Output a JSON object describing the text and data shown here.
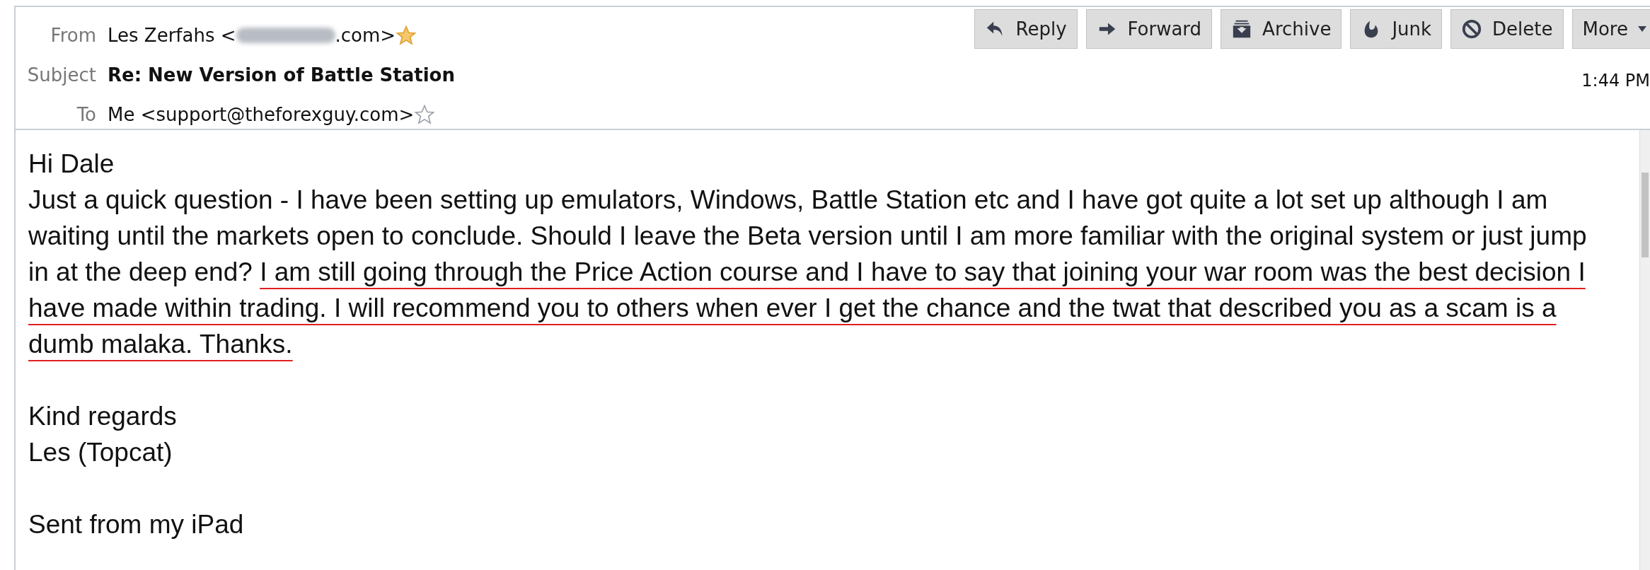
{
  "toolbar": [
    {
      "kind": "reply",
      "label": "Reply"
    },
    {
      "kind": "forward",
      "label": "Forward"
    },
    {
      "kind": "archive",
      "label": "Archive"
    },
    {
      "kind": "junk",
      "label": "Junk"
    },
    {
      "kind": "delete",
      "label": "Delete"
    },
    {
      "kind": "more",
      "label": "More"
    }
  ],
  "header": {
    "from": {
      "label": "From",
      "name": "Les Zerfahs <",
      "address_end": ".com>",
      "redacted": true,
      "starred": true
    },
    "subject": {
      "label": "Subject",
      "text": "Re: New Version of Battle Station"
    },
    "to": {
      "label": "To",
      "text": "Me <support@theforexguy.com>",
      "starred": false
    },
    "time": "1:44 PM"
  },
  "body": [
    [
      {
        "text": "Hi Dale"
      },
      {
        "segments": [
          {
            "text": "Just a quick question - I have been setting up emulators, Windows, Battle Station etc and I have got quite a lot set up although I am waiting until the markets open to conclude. Should I leave the Beta version until I am more familiar with the original system or just jump in at the deep end? ",
            "underlined": false
          },
          {
            "text": "I am still going through the Price Action course and I have to say that joining your war room was the best decision I have made within trading. I will recommend you to others when ever I get the chance and the twat that described you as a scam is a dumb malaka. Thanks.",
            "underlined": true
          }
        ]
      }
    ],
    [
      {
        "text": "Kind regards"
      },
      {
        "text": "Les (Topcat)"
      }
    ],
    [
      {
        "text": "Sent from my iPad"
      }
    ]
  ]
}
